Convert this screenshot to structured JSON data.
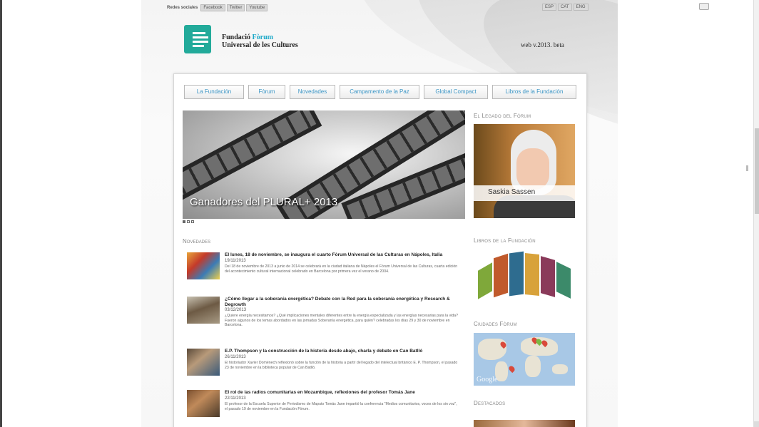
{
  "topbar": {
    "label": "Redes sociales",
    "social": [
      "Facebook",
      "Twitter",
      "Youtube"
    ],
    "langs": [
      "ESP",
      "CAT",
      "ENG"
    ]
  },
  "header": {
    "title_line1_a": "Fundació",
    "title_line1_b": "Fòrum",
    "title_line2": "Universal de les Cultures",
    "web_version": "web v.2013. beta"
  },
  "nav": {
    "items": [
      "La Fundación",
      "Fòrum",
      "Novedades",
      "Campamento de la Paz",
      "Global Compact",
      "Libros de la Fundación"
    ]
  },
  "slider": {
    "caption": "Ganadores del PLURAL+ 2013"
  },
  "sidebar": {
    "legado_title": "El Legado del Fòrum",
    "legado_name": "Saskia Sassen",
    "libros_title": "Libros de la Fundación",
    "ciudades_title": "Ciudades Fòrum",
    "map_logo": "Google",
    "destacados_title": "Destacados"
  },
  "news": {
    "title": "Novedades",
    "items": [
      {
        "title": "El lunes, 18 de noviembre, se inaugura el cuarto Fòrum Universal de las Culturas en Nápoles, Italia",
        "date": "19/11/2013",
        "excerpt": "Del 18 de noviembre de 2013 a junio de 2014 se celebrará en la ciudad italiana de Nápoles el Fòrum Universal de las Culturas, cuarta edición del acontecimiento cultural internacional celebrado en Barcelona por primera vez el verano de 2004."
      },
      {
        "title": "¿Cómo llegar a la soberanía energética? Debate con la Red para la soberanía energética y Research & Degrowth",
        "date": "03/12/2013",
        "excerpt": "¿Quiere energía necesitamos? ¿Qué implicaciones mentales diferentes entre la energía especializada y las energías necesarias para la vida? Fueron algunos de los temas abordados en las jornadas Soberanía energética, para quién? celebradas los días 29 y 30 de noviembre en Barcelona."
      },
      {
        "title": "E.P. Thompson y la construcción de la historia desde abajo, charla y debate en Can Batlló",
        "date": "26/11/2013",
        "excerpt": "El historiador Xavier Domènech reflexionó sobre la función de la historia a partir del legado del intelectual británico E. P. Thompson, el pasado 23 de noviembre en la biblioteca popular de Can Batlló."
      },
      {
        "title": "El rol de las radios comunitarias en Mozambique, reflexiones del profesor Tomás Jane",
        "date": "22/11/2013",
        "excerpt": "El profesor de la Escuela Superior de Periodismo de Maputo Tomás Jane impartió la conferencia \"Medios comunitarios, voces de los sin voz\", el pasado 19 de noviembre en la Fundación Fòrum."
      }
    ]
  }
}
